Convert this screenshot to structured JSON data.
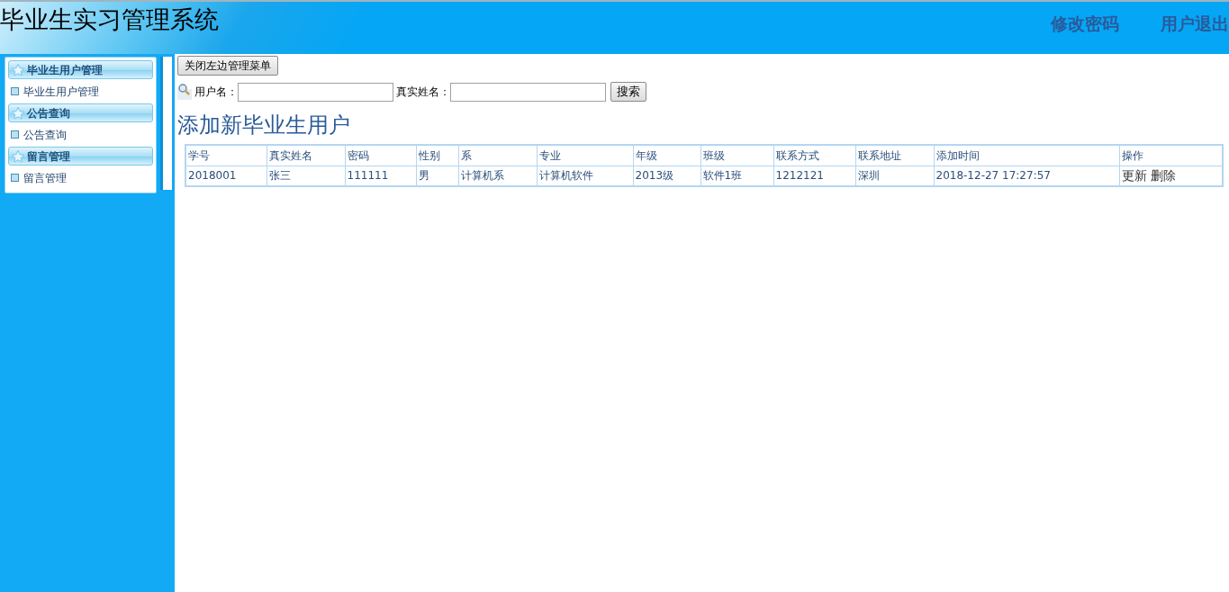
{
  "header": {
    "title": "毕业生实习管理系统",
    "links": [
      "修改密码",
      "用户退出"
    ]
  },
  "sidebar": {
    "sections": [
      {
        "title": "毕业生用户管理",
        "items": [
          "毕业生用户管理"
        ]
      },
      {
        "title": "公告查询",
        "items": [
          "公告查询"
        ]
      },
      {
        "title": "留言管理",
        "items": [
          "留言管理"
        ]
      }
    ]
  },
  "toggle_button": "关闭左边管理菜单",
  "search": {
    "fields": [
      {
        "label": "用户名："
      },
      {
        "label": "真实姓名："
      }
    ],
    "button": "搜索"
  },
  "heading": "添加新毕业生用户",
  "table": {
    "columns": [
      "学号",
      "真实姓名",
      "密码",
      "性别",
      "系",
      "专业",
      "年级",
      "班级",
      "联系方式",
      "联系地址",
      "添加时间",
      "操作"
    ],
    "rows": [
      {
        "cells": [
          "2018001",
          "张三",
          "111111",
          "男",
          "计算机系",
          "计算机软件",
          "2013级",
          "软件1班",
          "1212121",
          "深圳",
          "2018-12-27 17:27:57"
        ],
        "actions": [
          "更新",
          "删除"
        ]
      }
    ]
  }
}
